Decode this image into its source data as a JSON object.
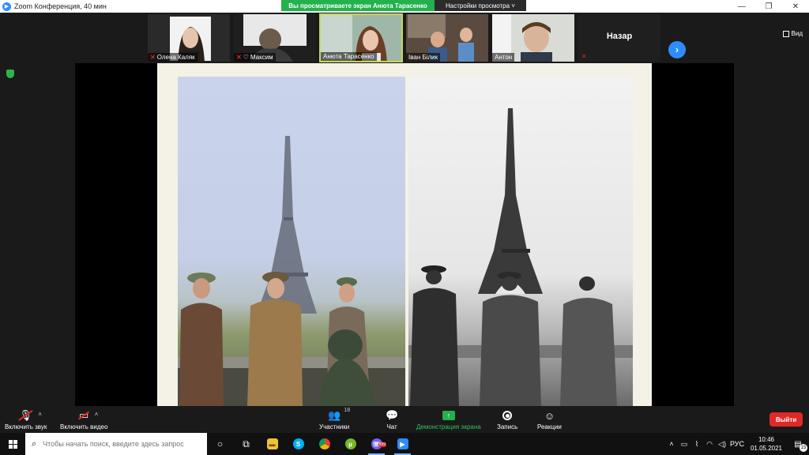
{
  "window": {
    "title": "Zoom Конференция, 40 мин",
    "minimize": "—",
    "maximize": "❐",
    "close": "✕"
  },
  "share_banner": {
    "status": "Вы просматриваете экран Анюта Тарасенко",
    "options_label": "Настройки просмотра"
  },
  "view_button": {
    "label": "Вид"
  },
  "participants": [
    {
      "name": "Олена Каляк",
      "muted": true
    },
    {
      "name": "Максим",
      "muted": true,
      "reaction": "heart"
    },
    {
      "name": "Анюта Тарасенко",
      "muted": false,
      "active": true
    },
    {
      "name": "Іван Білик",
      "muted": false
    },
    {
      "name": "Антон",
      "muted": false
    },
    {
      "name": "Назар",
      "muted": true,
      "video_off": true
    }
  ],
  "toolbar": {
    "unmute_label": "Включить звук",
    "start_video_label": "Включить видео",
    "participants_label": "Участники",
    "participants_count": "18",
    "chat_label": "Чат",
    "share_label": "Демонстрация экрана",
    "record_label": "Запись",
    "reactions_label": "Реакции",
    "leave_label": "Выйти"
  },
  "taskbar": {
    "search_placeholder": "Чтобы начать поиск, введите здесь запрос",
    "language": "РУС",
    "time": "10:46",
    "date": "01.05.2021",
    "notifications_count": "15",
    "viber_badge": "999",
    "apps": [
      "task-view",
      "file-explorer",
      "skype",
      "chrome",
      "utorrent",
      "viber",
      "zoom"
    ]
  },
  "colors": {
    "zoom_blue": "#2d8cff",
    "share_green": "#23b14d",
    "leave_red": "#e02828",
    "active_speaker": "#c5d65c"
  }
}
